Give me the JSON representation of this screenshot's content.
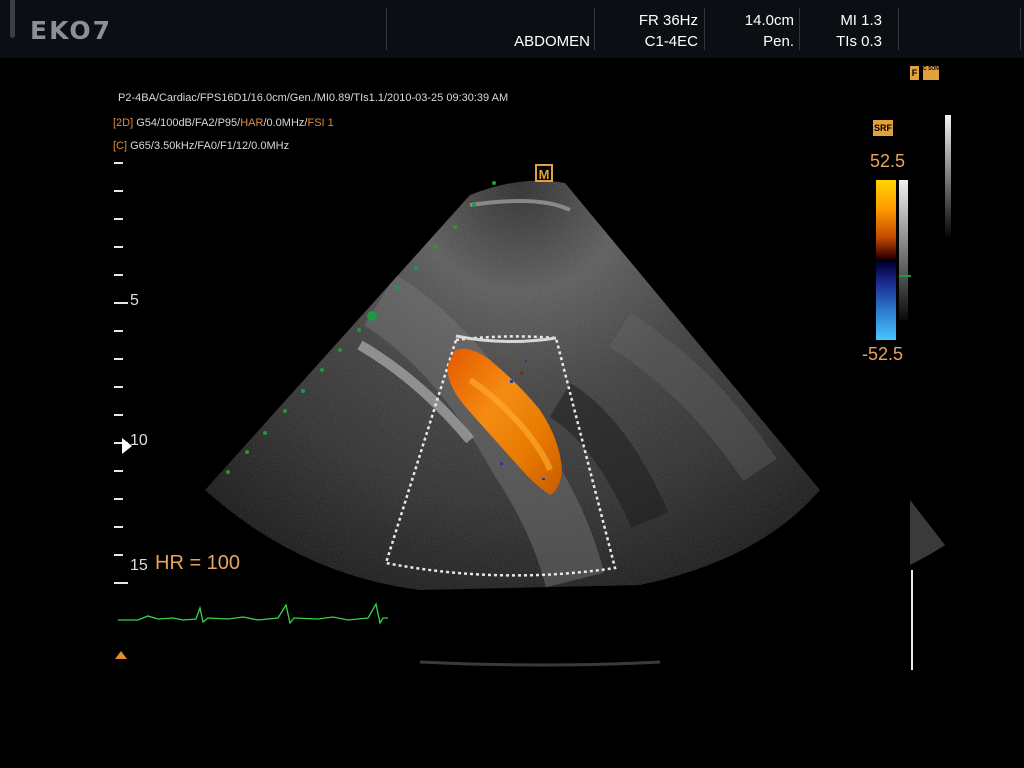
{
  "header": {
    "logo": "EKO7",
    "preset": "ABDOMEN",
    "frame_rate": "FR 36Hz",
    "probe": "C1-4EC",
    "depth": "14.0cm",
    "mode": "Pen.",
    "mi": "MI 1.3",
    "tis": "TIs 0.3"
  },
  "corner_icons": {
    "left": "F",
    "right": "C SON"
  },
  "info_lines": {
    "line1": "P2-4BA/Cardiac/FPS16D1/16.0cm/Gen./MI0.89/TIs1.1/2010-03-25 09:30:39 AM",
    "line2_prefix": "[2D]",
    "line2_main": " G54/100dB/FA2/P95/",
    "line2_har": "HAR",
    "line2_mid": "/0.0MHz/",
    "line2_fsi": "FSI 1",
    "line3_prefix": "[C]",
    "line3_main": " G65/3.50kHz/FA0/F1/12/0.0MHz"
  },
  "depth_scale": {
    "labels": [
      "5",
      "10",
      "15"
    ]
  },
  "color_scale": {
    "icon": "SRF",
    "max": "52.5",
    "min": "-52.5"
  },
  "focus_marker": "M",
  "heart_rate": "HR = 100",
  "colors": {
    "accent_orange": "#e18b3a",
    "doppler_orange": "#f08a1a",
    "ecg_green": "#39d24a",
    "marker_green": "#1e9a40"
  }
}
